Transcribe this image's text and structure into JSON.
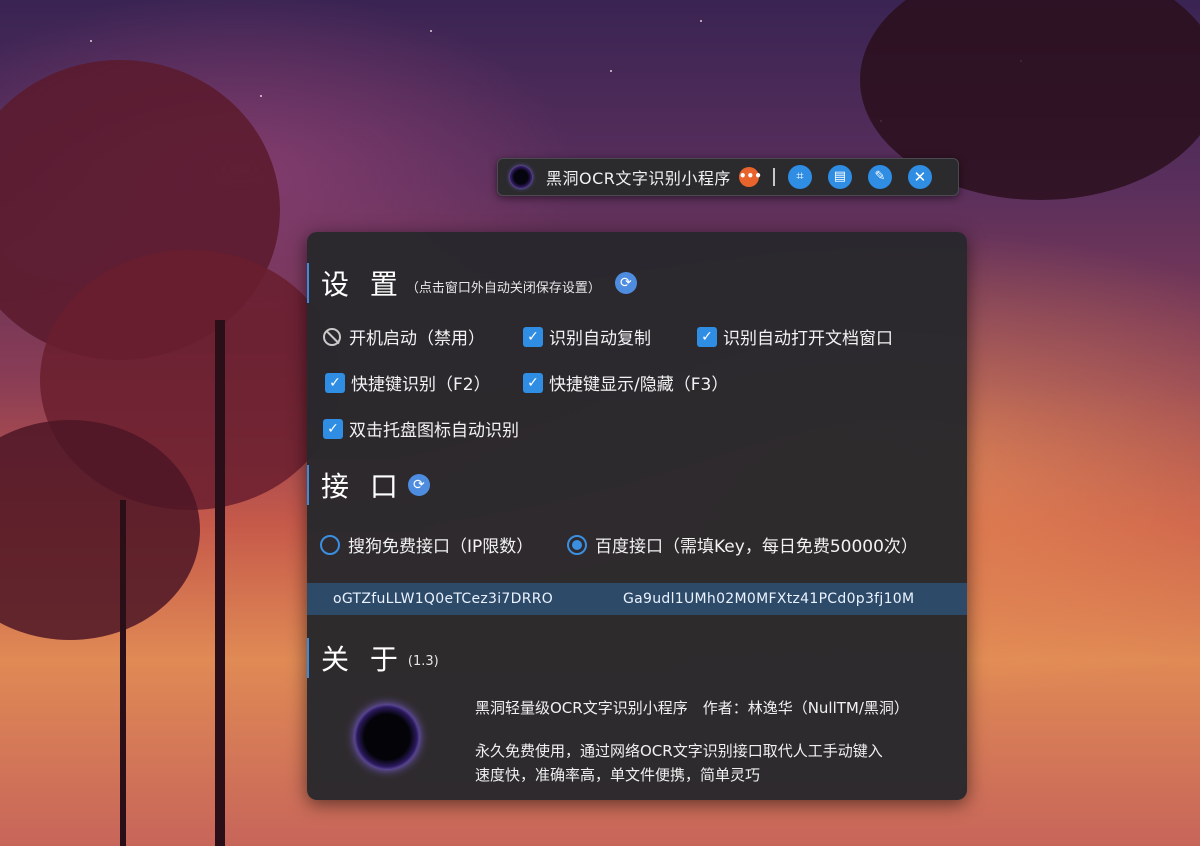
{
  "toolbar": {
    "title": "黑洞OCR文字识别小程序",
    "more_icon": "ellipsis-icon",
    "buttons": [
      {
        "name": "screenshot-capture-button",
        "icon": "⌗"
      },
      {
        "name": "document-button",
        "icon": "▤"
      },
      {
        "name": "settings-wrench-button",
        "icon": "🔧"
      },
      {
        "name": "close-button",
        "icon": "✕"
      }
    ]
  },
  "settings": {
    "title": "设 置",
    "note": "（点击窗口外自动关闭保存设置）",
    "options": {
      "autostart": "开机启动（禁用）",
      "auto_copy": "识别自动复制",
      "auto_open_doc": "识别自动打开文档窗口",
      "hotkey_recognize": "快捷键识别（F2）",
      "hotkey_toggle": "快捷键显示/隐藏（F3）",
      "tray_dblclick": "双击托盘图标自动识别"
    }
  },
  "api": {
    "title": "接 口",
    "sogou": "搜狗免费接口（IP限数）",
    "baidu": "百度接口（需填Key，每日免费50000次）",
    "selected": "baidu",
    "api_key": "oGTZfuLLW1Q0eTCez3i7DRRO",
    "secret_key": "Ga9udl1UMh02M0MFXtz41PCd0p3fj10M"
  },
  "about": {
    "title": "关 于",
    "version": "(1.3)",
    "line1": "黑洞轻量级OCR文字识别小程序　作者：林逸华（NullTM/黑洞）",
    "line2": "永久免费使用，通过网络OCR文字识别接口取代人工手动键入",
    "line3": "速度快，准确率高，单文件便携，简单灵巧"
  },
  "colors": {
    "accent": "#2f8de4",
    "panel_bg": "#28282c",
    "keybar_bg": "#2d4a68",
    "more_badge": "#e8642c"
  }
}
